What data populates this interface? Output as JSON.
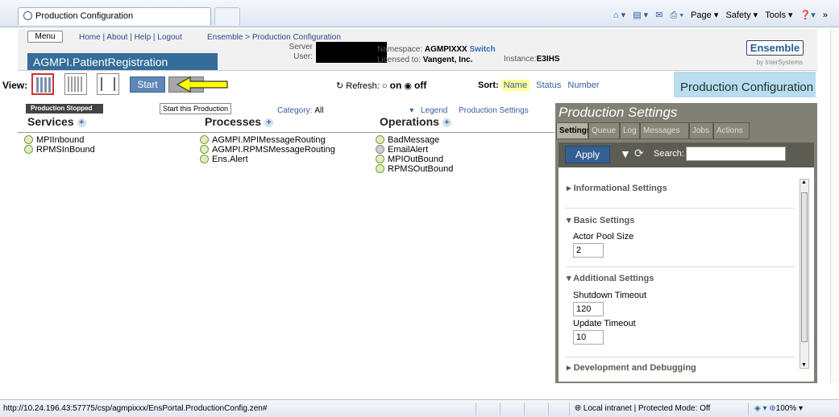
{
  "browser": {
    "tab_title": "Production Configuration",
    "commands": {
      "home_glyph": "⌂ ▾",
      "feeds_glyph": "▤ ▾",
      "mail_glyph": "✉",
      "print_glyph": "⎙ ▾",
      "page": "Page ▾",
      "safety": "Safety ▾",
      "tools": "Tools ▾",
      "help_glyph": "❓▾",
      "more": "»"
    }
  },
  "header": {
    "menu_label": "Menu",
    "top_links": "Home | About | Help | Logout",
    "breadcrumb": "Ensemble > Production Configuration",
    "production_name": "AGMPI.PatientRegistration",
    "server_label": "Server",
    "user_label": "User:",
    "namespace_label": "Namespace:",
    "namespace_value": "AGMPIXXX",
    "switch_label": "Switch",
    "licensed_label": "Licensed to:",
    "licensed_value": "Vangent, Inc.",
    "instance_label": "Instance:",
    "instance_value": "E3IHS",
    "brand": "Ensemble",
    "brand_sub": "by InterSystems"
  },
  "toolbar": {
    "view_label": "View:",
    "start_label": "Start",
    "refresh_label": "Refresh:",
    "refresh_on": "on",
    "refresh_off": "off",
    "refresh_selected": "off",
    "sort_label": "Sort:",
    "sort_name": "Name",
    "sort_status": "Status",
    "sort_number": "Number",
    "page_title": "Production Configuration"
  },
  "overview": {
    "stopped_badge": "Production Stopped",
    "tooltip": "Start this Production",
    "category_label": "Category:",
    "category_value": "All",
    "legend_label": "Legend",
    "settings_link": "Production Settings",
    "columns": {
      "services": "Services",
      "processes": "Processes",
      "operations": "Operations"
    },
    "services": [
      "MPIInbound",
      "RPMSInBound"
    ],
    "processes": [
      "AGMPI.MPIMessageRouting",
      "AGMPI.RPMSMessageRouting",
      "Ens.Alert"
    ],
    "operations": [
      {
        "name": "BadMessage",
        "state": "enabled"
      },
      {
        "name": "EmailAlert",
        "state": "disabled"
      },
      {
        "name": "MPIOutBound",
        "state": "enabled"
      },
      {
        "name": "RPMSOutBound",
        "state": "enabled"
      }
    ]
  },
  "settings_panel": {
    "title": "Production Settings",
    "tabs": [
      "Settings",
      "Queue",
      "Log",
      "Messages",
      "Jobs",
      "Actions"
    ],
    "active_tab": "Settings",
    "apply_label": "Apply",
    "search_label": "Search:",
    "search_value": "",
    "sections": {
      "informational": "Informational Settings",
      "basic": "Basic Settings",
      "additional": "Additional Settings",
      "development": "Development and Debugging"
    },
    "fields": {
      "actor_pool_size_label": "Actor Pool Size",
      "actor_pool_size_value": "2",
      "shutdown_timeout_label": "Shutdown Timeout",
      "shutdown_timeout_value": "120",
      "update_timeout_label": "Update Timeout",
      "update_timeout_value": "10"
    }
  },
  "statusbar": {
    "url": "http://10.24.196.43:57775/csp/agmpixxx/EnsPortal.ProductionConfig.zen#",
    "zone": "Local intranet | Protected Mode: Off",
    "zoom": "100%"
  },
  "colors": {
    "accent": "#356d99",
    "panel": "#808075",
    "enabled_dot": "#dfeec2",
    "disabled_dot": "#cfcfcf",
    "arrow": "#ffff00"
  }
}
